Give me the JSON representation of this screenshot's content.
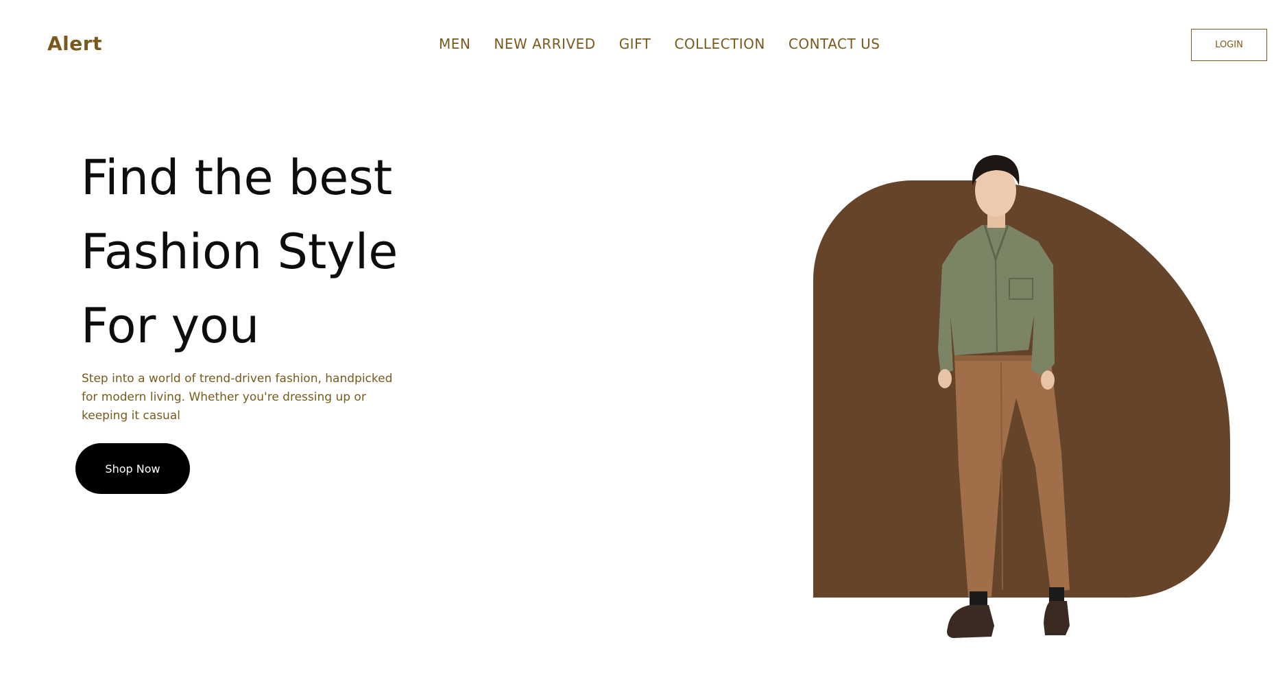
{
  "header": {
    "logo": "Alert",
    "nav": [
      "MEN",
      "NEW ARRIVED",
      "GIFT",
      "COLLECTION",
      "CONTACT US"
    ],
    "login_label": "LOGIN"
  },
  "hero": {
    "title_lines": [
      "Find the best",
      "Fashion Style",
      "For you"
    ],
    "description": "Step into a world of trend-driven fashion, handpicked for modern living. Whether you're dressing up or keeping it casual",
    "cta_label": "Shop Now"
  },
  "colors": {
    "brand": "#7a5a1c",
    "shape": "#66442a",
    "shirt": "#7c8466",
    "pants": "#a06f4a",
    "button": "#000000"
  }
}
